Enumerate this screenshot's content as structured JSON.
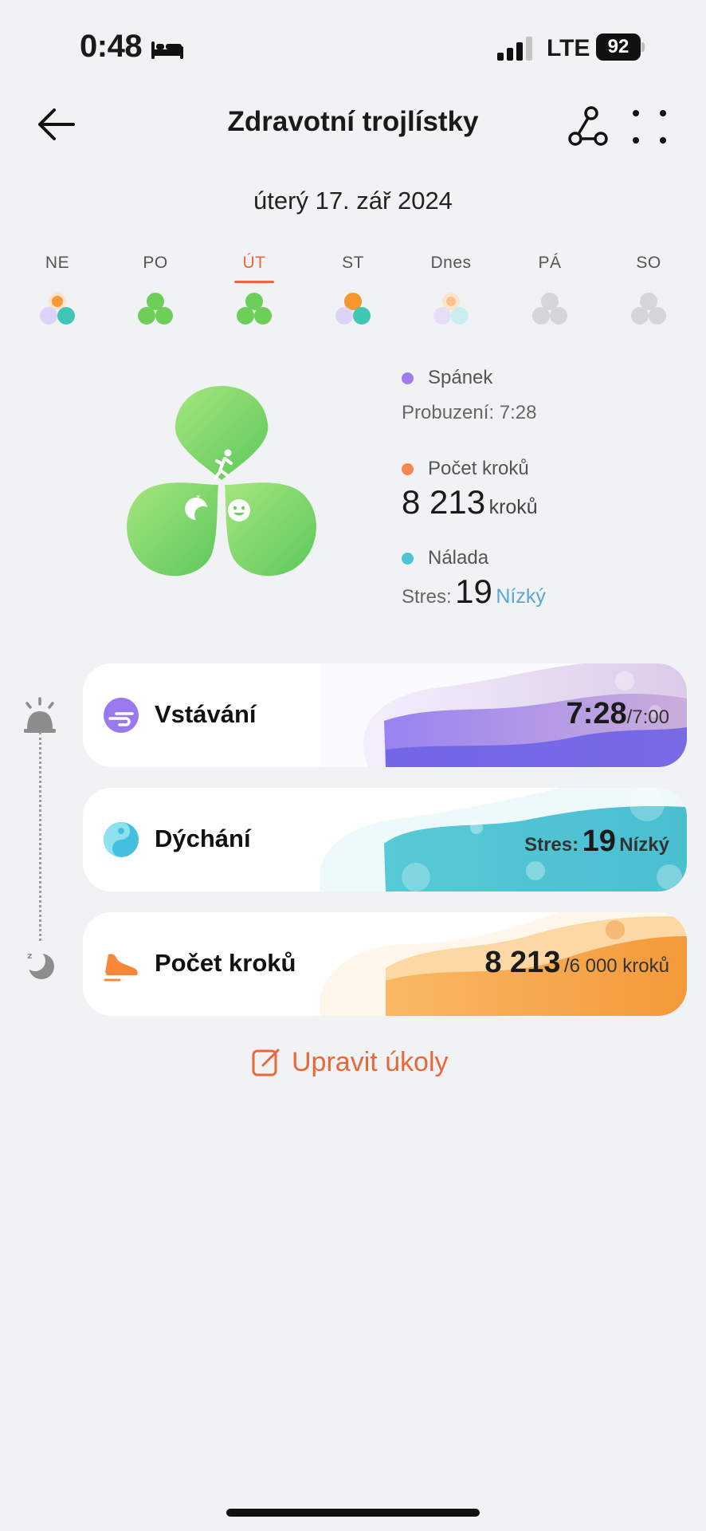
{
  "status_bar": {
    "time": "0:48",
    "network": "LTE",
    "battery": "92"
  },
  "header": {
    "title": "Zdravotní trojlístky"
  },
  "date": "úterý 17. zář 2024",
  "week": [
    {
      "label": "NE",
      "state": "mixed"
    },
    {
      "label": "PO",
      "state": "green"
    },
    {
      "label": "ÚT",
      "state": "green",
      "active": true
    },
    {
      "label": "ST",
      "state": "mixed"
    },
    {
      "label": "Dnes",
      "state": "pale"
    },
    {
      "label": "PÁ",
      "state": "grey"
    },
    {
      "label": "SO",
      "state": "grey"
    }
  ],
  "legend": {
    "sleep": {
      "title": "Spánek",
      "sub": "Probuzení: 7:28",
      "color": "#9f7df0"
    },
    "steps": {
      "title": "Počet kroků",
      "value": "8 213",
      "unit": "kroků",
      "color": "#f5874f"
    },
    "mood": {
      "title": "Nálada",
      "prefix": "Stres:",
      "value": "19",
      "level": "Nízký",
      "color": "#4fc2d4"
    }
  },
  "cards": {
    "wake": {
      "label": "Vstávání",
      "value": "7:28",
      "target": "/7:00"
    },
    "breath": {
      "label": "Dýchání",
      "prefix": "Stres:",
      "value": "19",
      "level": "Nízký"
    },
    "steps": {
      "label": "Počet kroků",
      "value": "8 213",
      "target": "/6 000 kroků"
    }
  },
  "edit_link": "Upravit úkoly",
  "colors": {
    "accent": "#e8683a",
    "clover_green": "#7ed66a",
    "stress_blue": "#5aa6d6"
  }
}
